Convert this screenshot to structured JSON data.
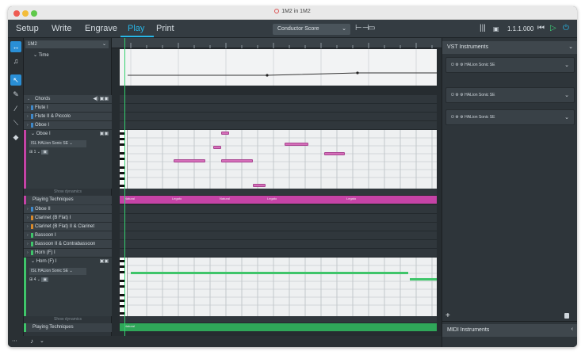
{
  "window": {
    "title": "1M2 in 1M2"
  },
  "toolbar": {
    "modes": [
      "Setup",
      "Write",
      "Engrave",
      "Play",
      "Print"
    ],
    "active_mode": "Play",
    "layout_select": "Conductor Score",
    "counter": "1.1.1.000",
    "accent": "#29b6e6",
    "play_color": "#3fd17a"
  },
  "tools": [
    "playhead-tool",
    "note-tool",
    "select-tool",
    "draw-tool",
    "line-tool",
    "erase-tool"
  ],
  "track_panel": {
    "flow": "1M2",
    "tempo_label": "Time",
    "chords_label": "Chords",
    "tracks_top": [
      {
        "name": "Flute I",
        "color": "#3f88c9"
      },
      {
        "name": "Flute II & Piccolo",
        "color": "#3f88c9"
      },
      {
        "name": "Oboe I",
        "color": "#3f88c9"
      }
    ],
    "oboe": {
      "name": "Oboe I",
      "sound": "ISL HALion Sonic SE",
      "channel": "1",
      "color": "#c543a6"
    },
    "show_dynamics": "Show dynamics",
    "playing_techniques": "Playing Techniques",
    "tracks_mid": [
      {
        "name": "Oboe II",
        "color": "#3f88c9"
      },
      {
        "name": "Clarinet (B Flat) I",
        "color": "#d8892b"
      },
      {
        "name": "Clarinet (B Flat) II & Clarinet",
        "color": "#d8892b"
      },
      {
        "name": "Bassoon I",
        "color": "#3fc56a"
      },
      {
        "name": "Bassoon II & Contrabassoon",
        "color": "#3fc56a"
      },
      {
        "name": "Horn (F) I",
        "color": "#3fc56a"
      }
    ],
    "horn": {
      "name": "Horn (F) I",
      "sound": "ISL HALion Sonic SE",
      "channel": "4",
      "color": "#3fc56a"
    }
  },
  "playing_technique_tags_oboe": [
    "Natural",
    "Legato",
    "Natural",
    "Legato",
    "Legato"
  ],
  "playing_technique_tags_horn": [
    "Natural"
  ],
  "right_panel": {
    "vst_header": "VST Instruments",
    "instruments": [
      "HALion Sonic SE",
      "HALion Sonic SE",
      "HALion Sonic SE"
    ],
    "midi_header": "MIDI Instruments"
  }
}
